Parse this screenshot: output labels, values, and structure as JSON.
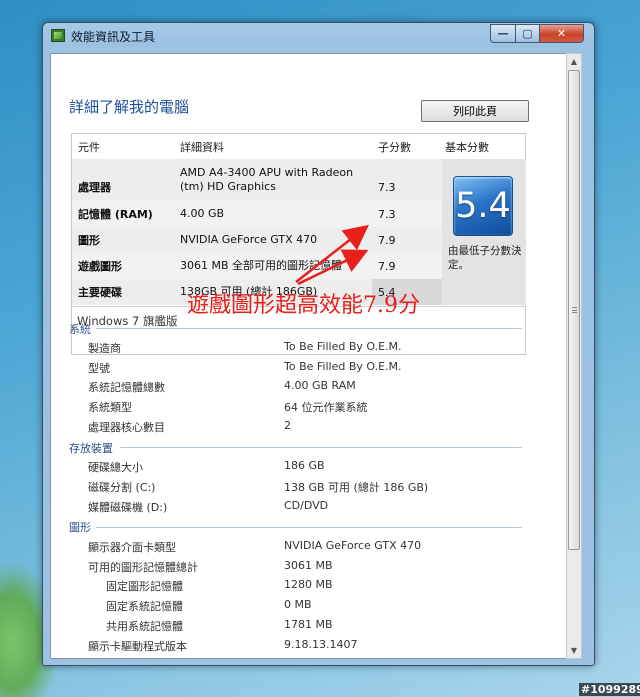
{
  "window": {
    "title": "效能資訊及工具",
    "minimize": "—",
    "maximize": "▢",
    "close": "✕"
  },
  "page": {
    "title": "詳細了解我的電腦",
    "print_button": "列印此頁"
  },
  "rating_table": {
    "headers": {
      "component": "元件",
      "details": "詳細資料",
      "subscore": "子分數",
      "base_score": "基本分數"
    },
    "rows": [
      {
        "component": "處理器",
        "details": "AMD A4-3400 APU with Radeon (tm) HD Graphics",
        "subscore": "7.3"
      },
      {
        "component": "記憶體 (RAM)",
        "details": "4.00 GB",
        "subscore": "7.3"
      },
      {
        "component": "圖形",
        "details": "NVIDIA GeForce GTX 470",
        "subscore": "7.9"
      },
      {
        "component": "遊戲圖形",
        "details": "3061 MB 全部可用的圖形記憶體",
        "subscore": "7.9"
      },
      {
        "component": "主要硬碟",
        "details": "138GB 可用 (總計 186GB)",
        "subscore": "5.4"
      }
    ],
    "base_score": "5.4",
    "base_score_note": "由最低子分數決定。",
    "edition": "Windows 7 旗艦版"
  },
  "annotation": {
    "text": "遊戲圖形超高效能7.9分",
    "color": "#e8201c"
  },
  "sections": {
    "system": {
      "heading": "系統",
      "items": [
        {
          "label": "製造商",
          "value": "To Be Filled By O.E.M."
        },
        {
          "label": "型號",
          "value": "To Be Filled By O.E.M."
        },
        {
          "label": "系統記憶體總數",
          "value": "4.00 GB RAM"
        },
        {
          "label": "系統類型",
          "value": "64 位元作業系統"
        },
        {
          "label": "處理器核心數目",
          "value": "2"
        }
      ]
    },
    "storage": {
      "heading": "存放裝置",
      "items": [
        {
          "label": "硬碟總大小",
          "value": "186 GB"
        },
        {
          "label": "磁碟分割 (C:)",
          "value": "138 GB 可用 (總計 186 GB)"
        },
        {
          "label": "媒體磁碟機 (D:)",
          "value": "CD/DVD"
        }
      ]
    },
    "graphics": {
      "heading": "圖形",
      "items": [
        {
          "label": "顯示器介面卡類型",
          "value": "NVIDIA GeForce GTX 470"
        },
        {
          "label": "可用的圖形記憶體總計",
          "value": "3061 MB"
        },
        {
          "label": "固定圖形記憶體",
          "value": "1280 MB"
        },
        {
          "label": "固定系統記憶體",
          "value": "0 MB"
        },
        {
          "label": "共用系統記憶體",
          "value": "1781 MB"
        },
        {
          "label": "顯示卡驅動程式版本",
          "value": "9.18.13.1407"
        }
      ]
    }
  },
  "watermark": "#1099289"
}
